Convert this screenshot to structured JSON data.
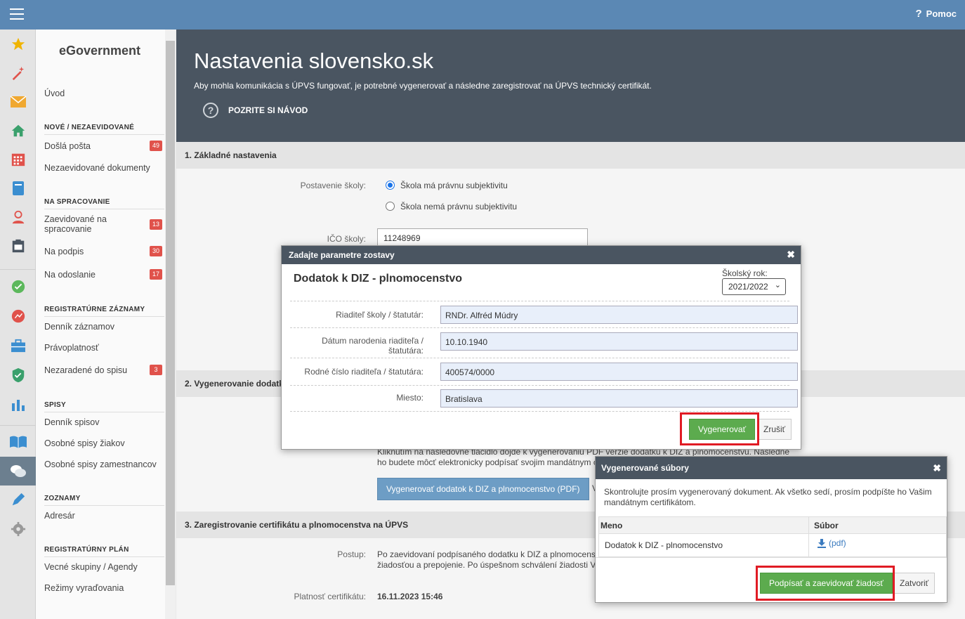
{
  "topbar": {
    "help_label": "Pomoc",
    "help_icon": "question-icon",
    "menu_icon": "hamburger-icon"
  },
  "iconbar": {
    "items": [
      "star-icon",
      "wand-icon",
      "mail-icon",
      "home-icon",
      "calendar-grid-icon",
      "book-icon",
      "person-icon",
      "clipboard-icon",
      "check-circle-icon",
      "chart-circle-icon",
      "briefcase-icon",
      "shield-icon",
      "bar-chart-icon",
      "open-book-icon",
      "chat-icon",
      "pen-icon",
      "gear-icon"
    ]
  },
  "menu": {
    "brand": "eGovernment",
    "home": "Úvod",
    "sec_new": "NOVÉ / NEZAEVIDOVANÉ",
    "incoming": "Došlá pošta",
    "incoming_count": "49",
    "unregistered": "Nezaevidované dokumenty",
    "sec_processing": "NA SPRACOVANIE",
    "registered_line1": "Zaevidované na",
    "registered_line2": "spracovanie",
    "registered_count": "13",
    "to_sign": "Na podpis",
    "to_sign_count": "30",
    "to_send": "Na odoslanie",
    "to_send_count": "17",
    "sec_registry": "REGISTRATÚRNE ZÁZNAMY",
    "journal": "Denník záznamov",
    "validity": "Právoplatnosť",
    "unfiled": "Nezaradené do spisu",
    "unfiled_count": "3",
    "sec_files": "SPISY",
    "files_journal": "Denník spisov",
    "student_files": "Osobné spisy žiakov",
    "staff_files": "Osobné spisy zamestnancov",
    "sec_lists": "ZOZNAMY",
    "address_book": "Adresár",
    "sec_plan": "REGISTRATÚRNY PLÁN",
    "groups": "Vecné skupiny / Agendy",
    "disposal": "Režimy vyraďovania"
  },
  "hero": {
    "title": "Nastavenia slovensko.sk",
    "subtitle": "Aby mohla komunikácia s ÚPVS fungovať, je potrebné vygenerovať a následne zaregistrovať na ÚPVS technický certifikát.",
    "guide": "POZRITE SI NÁVOD"
  },
  "section1": {
    "title": "1. Základné nastavenia",
    "status_label": "Postavenie školy:",
    "radio1": "Škola má právnu subjektivitu",
    "radio2": "Škola nemá právnu subjektivitu",
    "ico_label": "IČO školy:",
    "ico_value": "11248969"
  },
  "section2": {
    "title": "2. Vygenerovanie dodatk",
    "text_line1": "Kliknutím na nasledovné tlačidlo dôjde k vygenerovaniu PDF verzie dodatku k DIZ a plnomocenstvu. Následne",
    "text_line2": "ho budete môcť elektronicky podpísať svojim mandátnym c",
    "button": "Vygenerovať dodatok k DIZ a plnomocenstvo (PDF)",
    "button_arrow": "V"
  },
  "section3": {
    "title": "3. Zaregistrovanie certifikátu a plnomocenstva na ÚPVS",
    "procedure_label": "Postup:",
    "procedure_line1": "Po zaevidovaní podpísaného dodatku k DIZ a plnomocens",
    "procedure_line2": "žiadosťou a prepojenie. Po úspešnom schválení žiadosti V",
    "validity_label": "Platnosť certifikátu:",
    "validity_value": "16.11.2023 15:46"
  },
  "dialog1": {
    "title": "Zadajte parametre zostavy",
    "heading": "Dodatok k DIZ - plnomocenstvo",
    "year_label": "Školský rok:",
    "year_value": "2021/2022",
    "director_label": "Riaditeľ školy / štatutár:",
    "director_value": "RNDr. Alfréd Múdry",
    "dob_label_line1": "Dátum narodenia riaditeľa /",
    "dob_label_line2": "štatutára:",
    "dob_value": "10.10.1940",
    "id_label": "Rodné číslo riaditeľa / štatutára:",
    "id_value": "400574/0000",
    "place_label": "Miesto:",
    "place_value": "Bratislava",
    "generate": "Vygenerovať",
    "cancel": "Zrušiť"
  },
  "dialog2": {
    "title": "Vygenerované súbory",
    "message_line1": "Skontrolujte prosím vygenerovaný dokument. Ak všetko sedí, prosím podpíšte ho Vašim",
    "message_line2": "mandátnym certifikátom.",
    "col_name": "Meno",
    "col_file": "Súbor",
    "row_name": "Dodatok k DIZ - plnomocenstvo",
    "row_file": "(pdf)",
    "sign": "Podpísať a zaevidovať žiadosť",
    "close": "Zatvoriť"
  },
  "colors": {
    "topbar": "#5b88b4",
    "hero": "#4a5561",
    "green": "#5cab4e",
    "badge": "#e0524b",
    "highlight": "#e01b24"
  }
}
